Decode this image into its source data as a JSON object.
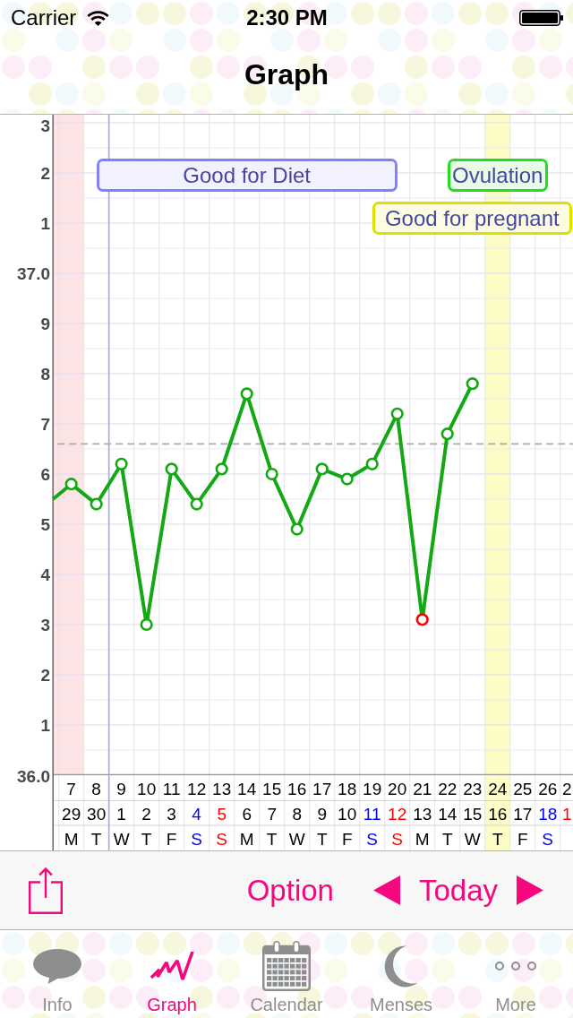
{
  "status_bar": {
    "carrier": "Carrier",
    "time": "2:30 PM"
  },
  "nav_bar": {
    "title": "Graph"
  },
  "graph": {
    "chart_data": {
      "type": "line",
      "marker": "circle",
      "xlim": [
        6.27,
        27.01
      ],
      "ylim": [
        36.0,
        37.316
      ],
      "xticks": [
        7,
        8,
        9,
        10,
        11,
        12,
        13,
        14,
        15,
        16,
        17,
        18,
        19,
        20,
        21,
        22,
        23,
        24,
        25,
        26
      ],
      "yticks": [
        {
          "value": 37.0,
          "label": "37.0"
        },
        {
          "value": 36.0,
          "label": "36.0"
        }
      ],
      "x": [
        6.27,
        7,
        8,
        9,
        10,
        11,
        12,
        13,
        14,
        15,
        16,
        17,
        18,
        19,
        20,
        21,
        22,
        23
      ],
      "values": [
        36.55,
        36.58,
        36.54,
        36.62,
        36.3,
        36.61,
        36.54,
        36.61,
        36.76,
        36.6,
        36.49,
        36.61,
        36.59,
        36.62,
        36.72,
        36.31,
        36.68,
        36.78
      ],
      "bands": [
        {
          "axis": "x",
          "from": 6.27,
          "to": 7.5,
          "color": "#fde4e4"
        },
        {
          "axis": "x",
          "from": 23.5,
          "to": 24.5,
          "color": "#fcfcc6"
        },
        {
          "axis": "x",
          "from": 8,
          "to": 20,
          "label": "Good for Diet",
          "color": "#8080ff"
        },
        {
          "axis": "x",
          "from": 22,
          "to": 26,
          "label": "Ovulation",
          "color": "#22dd22"
        },
        {
          "axis": "x",
          "from": 19,
          "to": 27,
          "label": "Good for pregnant",
          "color": "#e0e000"
        }
      ],
      "ref_lines": [
        {
          "axis": "x",
          "value": 8.5
        },
        {
          "axis": "y",
          "value": 36.66
        }
      ]
    },
    "y_minor_labels": [
      "3",
      "2",
      "1",
      "9",
      "8",
      "7",
      "6",
      "5",
      "4",
      "3",
      "2",
      "1"
    ],
    "day_columns": [
      {
        "date": "29",
        "weekday": "M",
        "color": "#000000",
        "highlighted": false,
        "flagged": false
      },
      {
        "date": "30",
        "weekday": "T",
        "color": "#000000",
        "highlighted": false,
        "flagged": false
      },
      {
        "date": "1",
        "weekday": "W",
        "color": "#000000",
        "highlighted": false,
        "flagged": false
      },
      {
        "date": "2",
        "weekday": "T",
        "color": "#000000",
        "highlighted": false,
        "flagged": false
      },
      {
        "date": "3",
        "weekday": "F",
        "color": "#000000",
        "highlighted": false,
        "flagged": false
      },
      {
        "date": "4",
        "weekday": "S",
        "color": "#0000ff",
        "highlighted": false,
        "flagged": false
      },
      {
        "date": "5",
        "weekday": "S",
        "color": "#ff0000",
        "highlighted": false,
        "flagged": false
      },
      {
        "date": "6",
        "weekday": "M",
        "color": "#000000",
        "highlighted": false,
        "flagged": false
      },
      {
        "date": "7",
        "weekday": "T",
        "color": "#000000",
        "highlighted": false,
        "flagged": false
      },
      {
        "date": "8",
        "weekday": "W",
        "color": "#000000",
        "highlighted": false,
        "flagged": false
      },
      {
        "date": "9",
        "weekday": "T",
        "color": "#000000",
        "highlighted": false,
        "flagged": false
      },
      {
        "date": "10",
        "weekday": "F",
        "color": "#000000",
        "highlighted": false,
        "flagged": false
      },
      {
        "date": "11",
        "weekday": "S",
        "color": "#0000ff",
        "highlighted": false,
        "flagged": false
      },
      {
        "date": "12",
        "weekday": "S",
        "color": "#ff0000",
        "highlighted": false,
        "flagged": false
      },
      {
        "date": "13",
        "weekday": "M",
        "color": "#000000",
        "highlighted": false,
        "flagged": true
      },
      {
        "date": "14",
        "weekday": "T",
        "color": "#000000",
        "highlighted": false,
        "flagged": false
      },
      {
        "date": "15",
        "weekday": "W",
        "color": "#000000",
        "highlighted": false,
        "flagged": false
      },
      {
        "date": "16",
        "weekday": "T",
        "color": "#000000",
        "highlighted": true
      },
      {
        "date": "17",
        "weekday": "F",
        "color": "#000000",
        "highlighted": false
      },
      {
        "date": "18",
        "weekday": "S",
        "color": "#0000ff",
        "highlighted": false
      },
      {
        "cycle_day": "2",
        "date": "1",
        "color": "#ff0000",
        "highlighted": false
      }
    ]
  },
  "toolbar": {
    "option_label": "Option",
    "today_label": "Today"
  },
  "tab_bar": [
    {
      "label": "Info",
      "selected": false
    },
    {
      "label": "Graph",
      "selected": true
    },
    {
      "label": "Calendar",
      "selected": false
    },
    {
      "label": "Menses",
      "selected": false
    },
    {
      "label": "More",
      "selected": false
    }
  ]
}
